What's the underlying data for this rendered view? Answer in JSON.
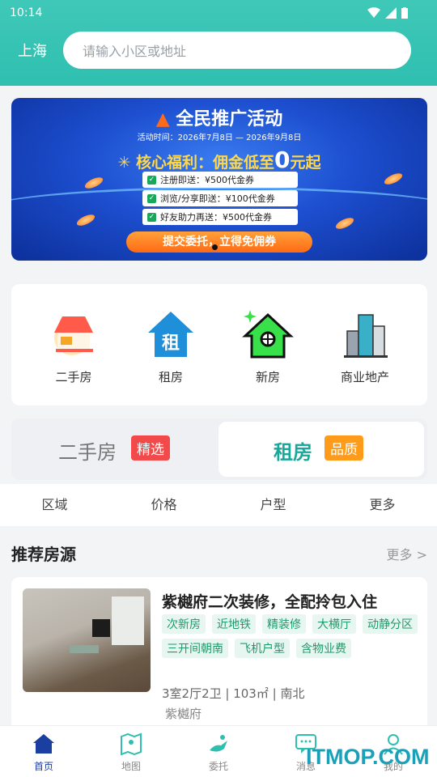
{
  "status": {
    "time": "10:14"
  },
  "header": {
    "city": "上海",
    "search_placeholder": "请输入小区或地址"
  },
  "banner": {
    "title": "全民推广活动",
    "time": "活动时间：2026年7月8日 — 2026年9月8日",
    "core_prefix": "核心福利：佣金低至",
    "core_zero": "0",
    "core_suffix": "元起",
    "rows": [
      "注册即送：¥500代金券",
      "浏览/分享即送：¥100代金券",
      "好友助力再送：¥500代金券"
    ],
    "button": "提交委托，立得免佣券"
  },
  "categories": [
    {
      "label": "二手房",
      "icon": "house-icon"
    },
    {
      "label": "租房",
      "icon": "rent-house-icon"
    },
    {
      "label": "新房",
      "icon": "new-house-icon"
    },
    {
      "label": "商业地产",
      "icon": "commercial-building-icon"
    }
  ],
  "toggle": {
    "tab1": "二手房",
    "tab1_tag": "精选",
    "tab2": "租房",
    "tab2_tag": "品质"
  },
  "filters": [
    "区域",
    "价格",
    "户型",
    "更多"
  ],
  "recommend": {
    "title": "推荐房源",
    "more": "更多 >",
    "item": {
      "title": "紫樾府二次装修，全配拎包入住",
      "tags": [
        "次新房",
        "近地铁",
        "精装修",
        "大横厅",
        "动静分区",
        "三开间朝南",
        "飞机户型",
        "含物业费"
      ],
      "meta": "3室2厅2卫 | 103㎡ | 南北",
      "community": "紫樾府"
    }
  },
  "nav": [
    {
      "label": "首页",
      "icon": "home-icon",
      "active": true
    },
    {
      "label": "地图",
      "icon": "map-icon",
      "active": false
    },
    {
      "label": "委托",
      "icon": "entrust-icon",
      "active": false
    },
    {
      "label": "消息",
      "icon": "message-icon",
      "active": false
    },
    {
      "label": "我的",
      "icon": "profile-icon",
      "active": false
    }
  ],
  "watermark": "ITMOP.COM",
  "colors": {
    "primary": "#2fbfb0",
    "accent_red": "#f24a4a",
    "accent_orange": "#ff9b1a",
    "nav_active": "#1a3fa0"
  }
}
